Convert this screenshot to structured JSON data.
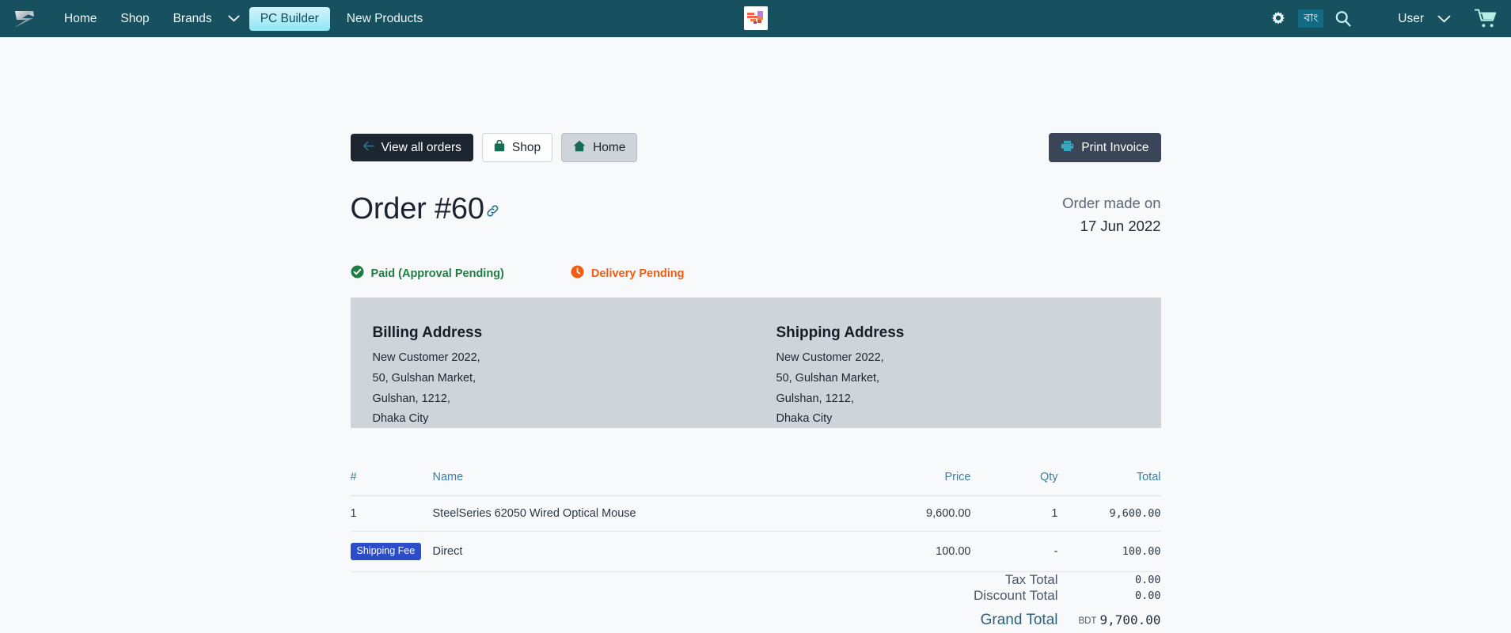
{
  "navbar": {
    "logo_icon": "brand-logo-icon",
    "items": [
      {
        "label": "Home",
        "active": false
      },
      {
        "label": "Shop",
        "active": false
      },
      {
        "label": "Brands",
        "active": false,
        "has_caret": true
      },
      {
        "label": "PC Builder",
        "active": true
      },
      {
        "label": "New Products",
        "active": false
      }
    ],
    "center_thumb": "site-thumbnail-image",
    "settings_icon": "gear-icon",
    "language_label": "বাং",
    "search_icon": "search-icon",
    "user_label": "User",
    "user_caret_icon": "chevron-down-icon",
    "cart_icon": "shopping-cart-icon",
    "bg_color": "#17505f",
    "active_pill_color": "#8fe6f5",
    "lang_bg_color": "#126b82"
  },
  "toolbar": {
    "view_all_orders": "View all orders",
    "back_icon": "arrow-left-icon",
    "shop": "Shop",
    "shop_icon": "shopping-bag-icon",
    "home": "Home",
    "home_icon": "home-icon",
    "print_invoice": "Print Invoice",
    "print_icon": "printer-icon"
  },
  "order": {
    "title": "Order #60",
    "link_icon": "link-icon",
    "date_label": "Order made on",
    "date_value": "17 Jun 2022",
    "payment_status": "Paid (Approval Pending)",
    "payment_status_icon": "check-circle-icon",
    "payment_status_color": "#1e7e42",
    "delivery_status": "Delivery Pending",
    "delivery_status_icon": "clock-icon",
    "delivery_status_color": "#ef5c14"
  },
  "addresses": {
    "panel_bg": "#ced4da",
    "billing": {
      "title": "Billing Address",
      "lines": [
        "New Customer 2022,",
        "50, Gulshan Market,",
        "Gulshan, 1212,",
        "Dhaka City"
      ]
    },
    "shipping": {
      "title": "Shipping Address",
      "lines": [
        "New Customer 2022,",
        "50, Gulshan Market,",
        "Gulshan, 1212,",
        "Dhaka City"
      ]
    }
  },
  "items_table": {
    "headers": {
      "index": "#",
      "name": "Name",
      "price": "Price",
      "qty": "Qty",
      "total": "Total"
    },
    "rows": [
      {
        "index": "1",
        "badge": "",
        "name": "SteelSeries 62050 Wired Optical Mouse",
        "price": "9,600.00",
        "qty": "1",
        "total": "9,600.00"
      },
      {
        "index": "",
        "badge": "Shipping Fee",
        "name": "Direct",
        "price": "100.00",
        "qty": "-",
        "total": "100.00"
      }
    ],
    "badge_color": "#2d4cc8"
  },
  "totals": {
    "tax_label": "Tax Total",
    "tax_value": "0.00",
    "discount_label": "Discount Total",
    "discount_value": "0.00",
    "grand_label": "Grand Total",
    "grand_currency": "BDT",
    "grand_value": "9,700.00"
  }
}
